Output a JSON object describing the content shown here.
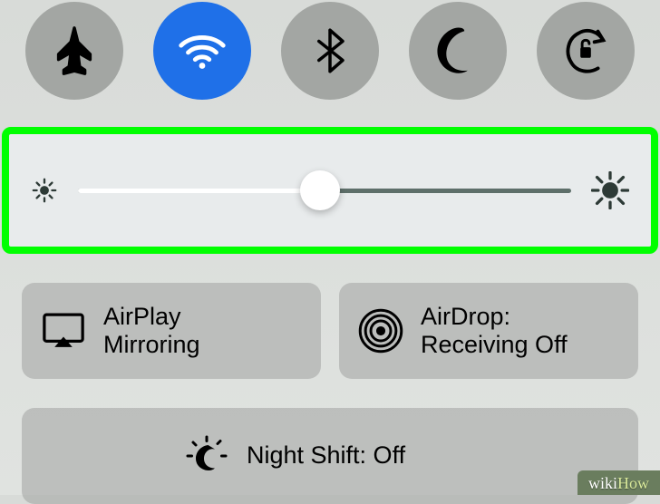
{
  "toggles": {
    "airplane": {
      "active": false
    },
    "wifi": {
      "active": true
    },
    "bluetooth": {
      "active": false
    },
    "dnd": {
      "active": false
    },
    "rotation_lock": {
      "active": false
    }
  },
  "brightness": {
    "percent": 49
  },
  "actions": {
    "airplay": {
      "line1": "AirPlay",
      "line2": "Mirroring"
    },
    "airdrop": {
      "line1": "AirDrop:",
      "line2": "Receiving Off"
    }
  },
  "nightshift": {
    "label": "Night Shift: Off"
  },
  "watermark": {
    "prefix": "wiki",
    "suffix": "How"
  }
}
